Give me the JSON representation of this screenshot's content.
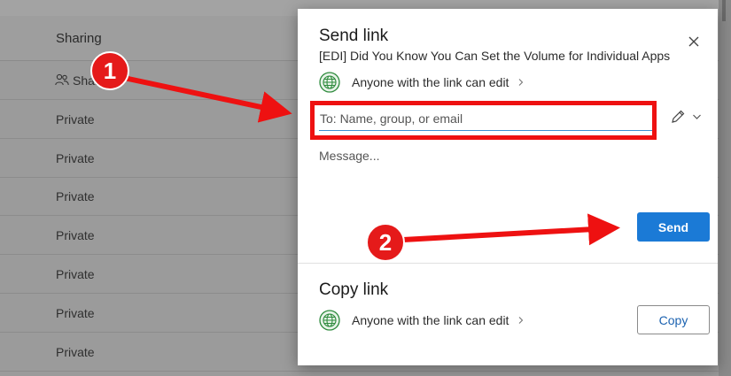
{
  "background": {
    "column_header": "Sharing",
    "rows": [
      "Shared",
      "Private",
      "Private",
      "Private",
      "Private",
      "Private",
      "Private",
      "Private"
    ]
  },
  "dialog": {
    "send_title": "Send link",
    "file_name": "[EDI] Did You Know You Can Set the Volume for Individual Apps",
    "permission": "Anyone with the link can edit",
    "to_placeholder": "To: Name, group, or email",
    "message_placeholder": "Message...",
    "send_label": "Send",
    "copy_title": "Copy link",
    "copy_permission": "Anyone with the link can edit",
    "copy_label": "Copy"
  },
  "annotations": {
    "badge_1": "1",
    "badge_2": "2"
  },
  "colors": {
    "accent": "#1b7ad6",
    "annotation_red": "#ee1111",
    "globe_green": "#2e8b3d"
  },
  "icons": [
    "globe-icon",
    "close-icon",
    "chevron-right-icon",
    "pencil-icon",
    "chevron-down-icon",
    "people-icon"
  ]
}
